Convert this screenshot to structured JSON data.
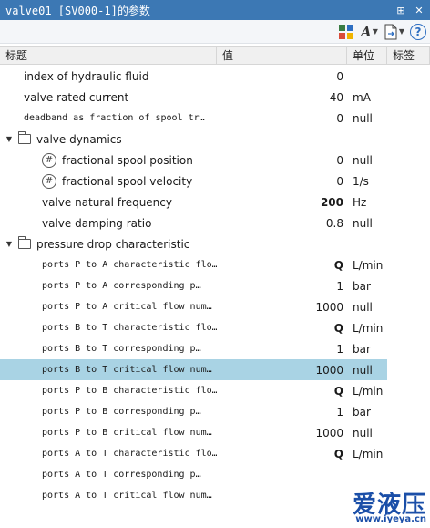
{
  "window": {
    "title": "valve01 [SV000-1]的参数",
    "pin_glyph": "⊞",
    "close_glyph": "✕"
  },
  "toolbar": {
    "colors": [
      "#3a7d44",
      "#2f6fc2",
      "#d94b3a",
      "#f0b400"
    ]
  },
  "columns": {
    "name": "标题",
    "value": "值",
    "unit": "单位",
    "tag": "标签"
  },
  "rows": [
    {
      "indent": 1,
      "font": "sans",
      "label": "index of hydraulic fluid",
      "value": "0",
      "unit": ""
    },
    {
      "indent": 1,
      "font": "sans",
      "label": "valve rated current",
      "value": "40",
      "unit": "mA"
    },
    {
      "indent": 1,
      "font": "mono",
      "label": "deadband as fraction of spool tr…",
      "value": "0",
      "unit": "null"
    },
    {
      "indent": 0,
      "group": true,
      "label": "valve dynamics"
    },
    {
      "indent": 2,
      "font": "sans",
      "hash": true,
      "label": "fractional spool position",
      "value": "0",
      "unit": "null"
    },
    {
      "indent": 2,
      "font": "sans",
      "hash": true,
      "label": "fractional spool velocity",
      "value": "0",
      "unit": "1/s"
    },
    {
      "indent": 2,
      "font": "sans",
      "label": "valve natural frequency",
      "value": "200",
      "bold": true,
      "unit": "Hz"
    },
    {
      "indent": 2,
      "font": "sans",
      "label": "valve damping ratio",
      "value": "0.8",
      "unit": "null"
    },
    {
      "indent": 0,
      "group": true,
      "label": "pressure drop characteristic"
    },
    {
      "indent": 2,
      "font": "mono",
      "label": "ports P to A characteristic flo…",
      "value": "Q",
      "bold": true,
      "unit": "L/min"
    },
    {
      "indent": 2,
      "font": "mono",
      "label": "ports P to A corresponding p…",
      "value": "1",
      "unit": "bar"
    },
    {
      "indent": 2,
      "font": "mono",
      "label": "ports P to A critical flow num…",
      "value": "1000",
      "unit": "null"
    },
    {
      "indent": 2,
      "font": "mono",
      "label": "ports B to T characteristic flo…",
      "value": "Q",
      "bold": true,
      "unit": "L/min"
    },
    {
      "indent": 2,
      "font": "mono",
      "label": "ports B to T corresponding p…",
      "value": "1",
      "unit": "bar"
    },
    {
      "indent": 2,
      "font": "mono",
      "label": "ports B to T critical flow num…",
      "value": "1000",
      "unit": "null",
      "selected": true
    },
    {
      "indent": 2,
      "font": "mono",
      "label": "ports P to B characteristic flo…",
      "value": "Q",
      "bold": true,
      "unit": "L/min"
    },
    {
      "indent": 2,
      "font": "mono",
      "label": "ports P to B corresponding p…",
      "value": "1",
      "unit": "bar"
    },
    {
      "indent": 2,
      "font": "mono",
      "label": "ports P to B critical flow num…",
      "value": "1000",
      "unit": "null"
    },
    {
      "indent": 2,
      "font": "mono",
      "label": "ports A to T characteristic flo…",
      "value": "Q",
      "bold": true,
      "unit": "L/min"
    },
    {
      "indent": 2,
      "font": "mono",
      "label": "ports A to T corresponding p…",
      "value": "",
      "unit": ""
    },
    {
      "indent": 2,
      "font": "mono",
      "label": "ports A to T critical flow num…",
      "value": "",
      "unit": ""
    }
  ],
  "watermark": {
    "logo": "爱液压",
    "url": "www.iyeya.cn"
  }
}
